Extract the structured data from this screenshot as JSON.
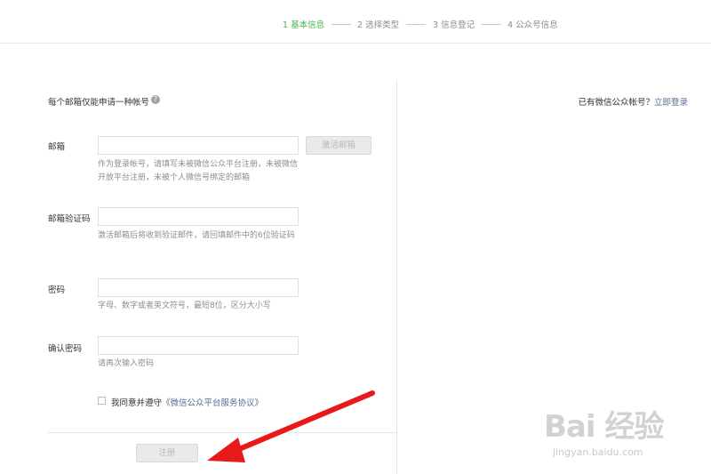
{
  "steps": [
    {
      "label": "1 基本信息",
      "active": true
    },
    {
      "label": "2 选择类型",
      "active": false
    },
    {
      "label": "3 信息登记",
      "active": false
    },
    {
      "label": "4 公众号信息",
      "active": false
    }
  ],
  "form": {
    "limit_text": "每个邮箱仅能申请一种帐号",
    "help_icon": "?",
    "email": {
      "label": "邮箱",
      "value": "",
      "activate_button": "激活邮箱",
      "tip": "作为登录帐号，请填写未被微信公众平台注册，未被微信开放平台注册，未被个人微信号绑定的邮箱"
    },
    "code": {
      "label": "邮箱验证码",
      "value": "",
      "tip": "激活邮箱后将收到验证邮件，请回填邮件中的6位验证码"
    },
    "password": {
      "label": "密码",
      "value": "",
      "tip": "字母、数字或者英文符号，最短8位，区分大小写"
    },
    "confirm": {
      "label": "确认密码",
      "value": "",
      "tip": "请再次输入密码"
    },
    "agree": {
      "checked": false,
      "prefix": "我同意并遵守",
      "link": "《微信公众平台服务协议》"
    },
    "register_button": "注册"
  },
  "login": {
    "prefix": "已有微信公众帐号？",
    "link": "立即登录"
  },
  "watermark": {
    "main": "Bai 经验",
    "sub": "jingyan.baidu.com"
  },
  "colors": {
    "accent_green": "#44b549",
    "link_blue": "#576b95",
    "arrow_red": "#e8191b"
  }
}
